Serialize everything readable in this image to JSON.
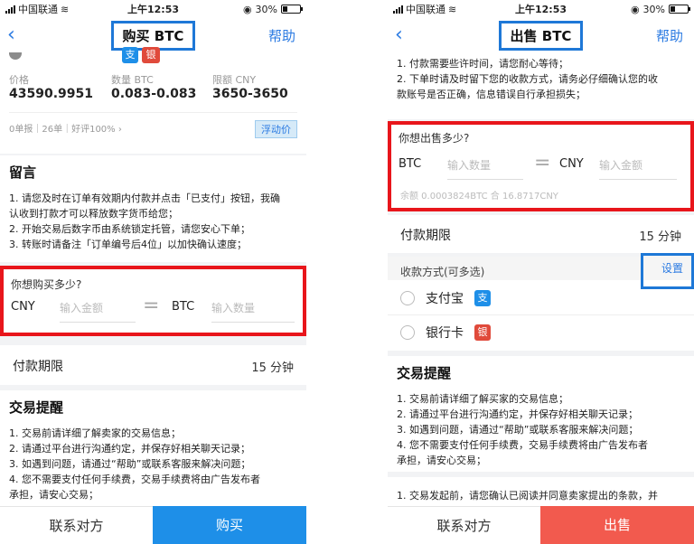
{
  "status_bar": {
    "carrier": "中国联通",
    "time": "上午12:53",
    "battery": "30%"
  },
  "colors": {
    "accent": "#2a7ae2",
    "buy": "#1e8fe8",
    "sell": "#f25a4e",
    "highlight_red": "#e8151b",
    "highlight_blue": "#1e78d7"
  },
  "left": {
    "title": "购买 BTC",
    "help": "帮助",
    "info": {
      "price_label": "价格",
      "price": "43590.9951",
      "qty_label": "数量 BTC",
      "qty": "0.083-0.083",
      "limit_label": "限额 CNY",
      "limit": "3650-3650",
      "stats": "0单报｜26单｜好评100% ›",
      "float_tag": "浮动价"
    },
    "message": {
      "title": "留言",
      "lines": [
        "1. 请您及时在订单有效期内付款并点击「已支付」按钮，我确",
        "认收到打款才可以释放数字货币给您；",
        "2. 开始交易后数字币由系统锁定托管，请您安心下单；",
        "3. 转账时请备注「订单编号后4位」以加快确认速度；"
      ]
    },
    "amount": {
      "question": "你想购买多少?",
      "cur1": "CNY",
      "ph1": "输入金额",
      "cur2": "BTC",
      "ph2": "输入数量"
    },
    "payment_period": {
      "label": "付款期限",
      "value": "15 分钟"
    },
    "tips": {
      "title": "交易提醒",
      "lines": [
        "1. 交易前请详细了解卖家的交易信息；",
        "2. 请通过平台进行沟通约定，并保存好相关聊天记录；",
        "3. 如遇到问题，请通过“帮助”或联系客服来解决问题；",
        "4. 您不需要支付任何手续费，交易手续费将由广告发布者",
        "承担，请安心交易；"
      ]
    },
    "contact": "联系对方",
    "action": "购买"
  },
  "right": {
    "title": "出售 BTC",
    "help": "帮助",
    "top_lines": [
      "1. 付款需要些许时间，请您耐心等待；",
      "2. 下单时请及时留下您的收款方式，请务必仔细确认您的收",
      "款账号是否正确，信息错误自行承担损失；"
    ],
    "amount": {
      "question": "你想出售多少?",
      "cur1": "BTC",
      "ph1": "输入数量",
      "cur2": "CNY",
      "ph2": "输入金额",
      "balance": "余额 0.0003824BTC 合 16.8717CNY"
    },
    "payment_period": {
      "label": "付款期限",
      "value": "15 分钟"
    },
    "receive": {
      "label": "收款方式(可多选)",
      "settings": "设置",
      "options": [
        {
          "label": "支付宝",
          "icon": "alipay-icon",
          "glyph": "支"
        },
        {
          "label": "银行卡",
          "icon": "bank-card-icon",
          "glyph": "银"
        }
      ]
    },
    "tips": {
      "title": "交易提醒",
      "lines": [
        "1. 交易前请详细了解买家的交易信息；",
        "2. 请通过平台进行沟通约定，并保存好相关聊天记录；",
        "3. 如遇到问题，请通过“帮助”或联系客服来解决问题；",
        "4. 您不需要支付任何手续费，交易手续费将由广告发布者",
        "承担，请安心交易；"
      ]
    },
    "bottom_note": "1. 交易发起前，请您确认已阅读并同意卖家提出的条款，并",
    "contact": "联系对方",
    "action": "出售"
  }
}
